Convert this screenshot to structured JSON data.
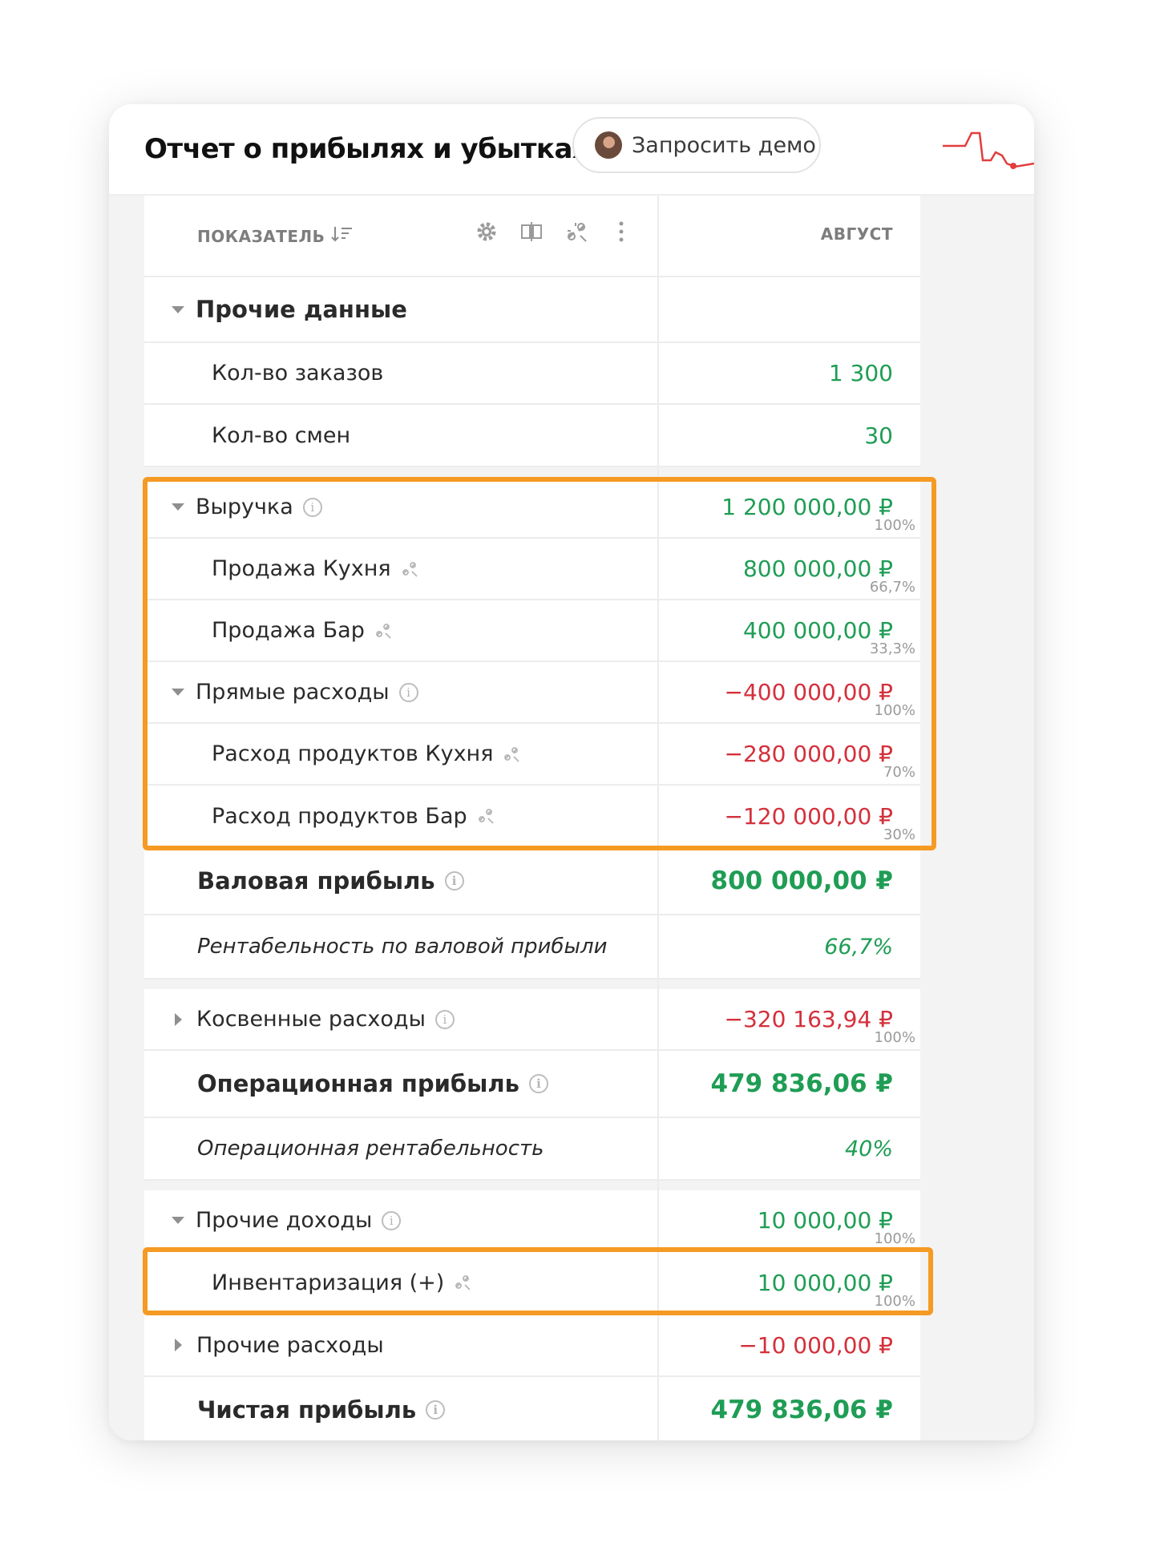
{
  "header": {
    "title": "Отчет о прибылях и убытках",
    "demo_button": "Запросить демо"
  },
  "table": {
    "col_indicator": "ПОКАЗАТЕЛЬ",
    "col_month": "АВГУСТ"
  },
  "rows": {
    "other_data": {
      "label": "Прочие данные"
    },
    "orders": {
      "label": "Кол-во заказов",
      "value": "1 300"
    },
    "shifts": {
      "label": "Кол-во смен",
      "value": "30"
    },
    "revenue": {
      "label": "Выручка",
      "value": "1 200 000,00 ₽",
      "pct": "100%"
    },
    "sale_kitchen": {
      "label": "Продажа Кухня",
      "value": "800 000,00 ₽",
      "pct": "66,7%"
    },
    "sale_bar": {
      "label": "Продажа Бар",
      "value": "400 000,00 ₽",
      "pct": "33,3%"
    },
    "direct_costs": {
      "label": "Прямые расходы",
      "value": "−400 000,00 ₽",
      "pct": "100%"
    },
    "cost_kitchen": {
      "label": "Расход продуктов Кухня",
      "value": "−280 000,00 ₽",
      "pct": "70%"
    },
    "cost_bar": {
      "label": "Расход продуктов Бар",
      "value": "−120 000,00 ₽",
      "pct": "30%"
    },
    "gross_profit": {
      "label": "Валовая прибыль",
      "value": "800 000,00 ₽"
    },
    "gross_margin": {
      "label": "Рентабельность по валовой прибыли",
      "value": "66,7%"
    },
    "indirect_costs": {
      "label": "Косвенные расходы",
      "value": "−320 163,94 ₽",
      "pct": "100%"
    },
    "operating_profit": {
      "label": "Операционная прибыль",
      "value": "479 836,06 ₽"
    },
    "operating_margin": {
      "label": "Операционная рентабельность",
      "value": "40%"
    },
    "other_income": {
      "label": "Прочие доходы",
      "value": "10 000,00 ₽",
      "pct": "100%"
    },
    "inventory": {
      "label": "Инвентаризация (+)",
      "value": "10 000,00 ₽",
      "pct": "100%"
    },
    "other_expenses": {
      "label": "Прочие расходы",
      "value": "−10 000,00 ₽"
    },
    "net_profit": {
      "label": "Чистая прибыль",
      "value": "479 836,06 ₽"
    }
  },
  "icons": {
    "sort": "sort-icon",
    "settings": "gear-icon",
    "columns": "columns-icon",
    "link": "unlink-icon",
    "more": "more-vertical-icon",
    "info": "info-icon"
  },
  "colors": {
    "positive": "#1f9d55",
    "negative": "#d4303c",
    "highlight": "#f59a23",
    "accent": "#72d4e6"
  }
}
